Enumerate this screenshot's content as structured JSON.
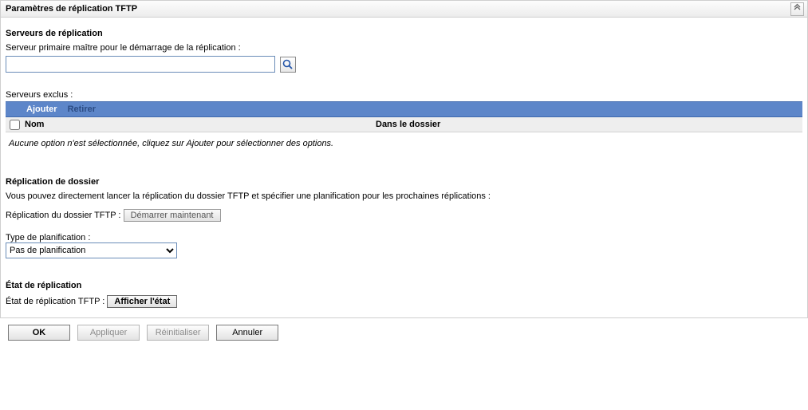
{
  "panel": {
    "title": "Paramètres de réplication TFTP"
  },
  "servers": {
    "heading": "Serveurs de réplication",
    "primary_label": "Serveur primaire maître pour le démarrage de la réplication :",
    "primary_value": "",
    "excluded_label": "Serveurs exclus :",
    "toolbar": {
      "add": "Ajouter",
      "remove": "Retirer"
    },
    "columns": {
      "name": "Nom",
      "folder": "Dans le dossier"
    },
    "empty_text": "Aucune option n'est sélectionnée, cliquez sur Ajouter pour sélectionner des options."
  },
  "folder": {
    "heading": "Réplication de dossier",
    "desc": "Vous pouvez directement lancer la réplication du dossier TFTP et spécifier une planification pour les prochaines réplications :",
    "replicate_label": "Réplication du dossier TFTP :",
    "start_now": "Démarrer maintenant",
    "sched_type_label": "Type de planification :",
    "sched_options": [
      "Pas de planification"
    ],
    "sched_selected": "Pas de planification"
  },
  "status": {
    "heading": "État de réplication",
    "label": "État de réplication TFTP :",
    "show": "Afficher l'état"
  },
  "buttons": {
    "ok": "OK",
    "apply": "Appliquer",
    "reset": "Réinitialiser",
    "cancel": "Annuler"
  }
}
